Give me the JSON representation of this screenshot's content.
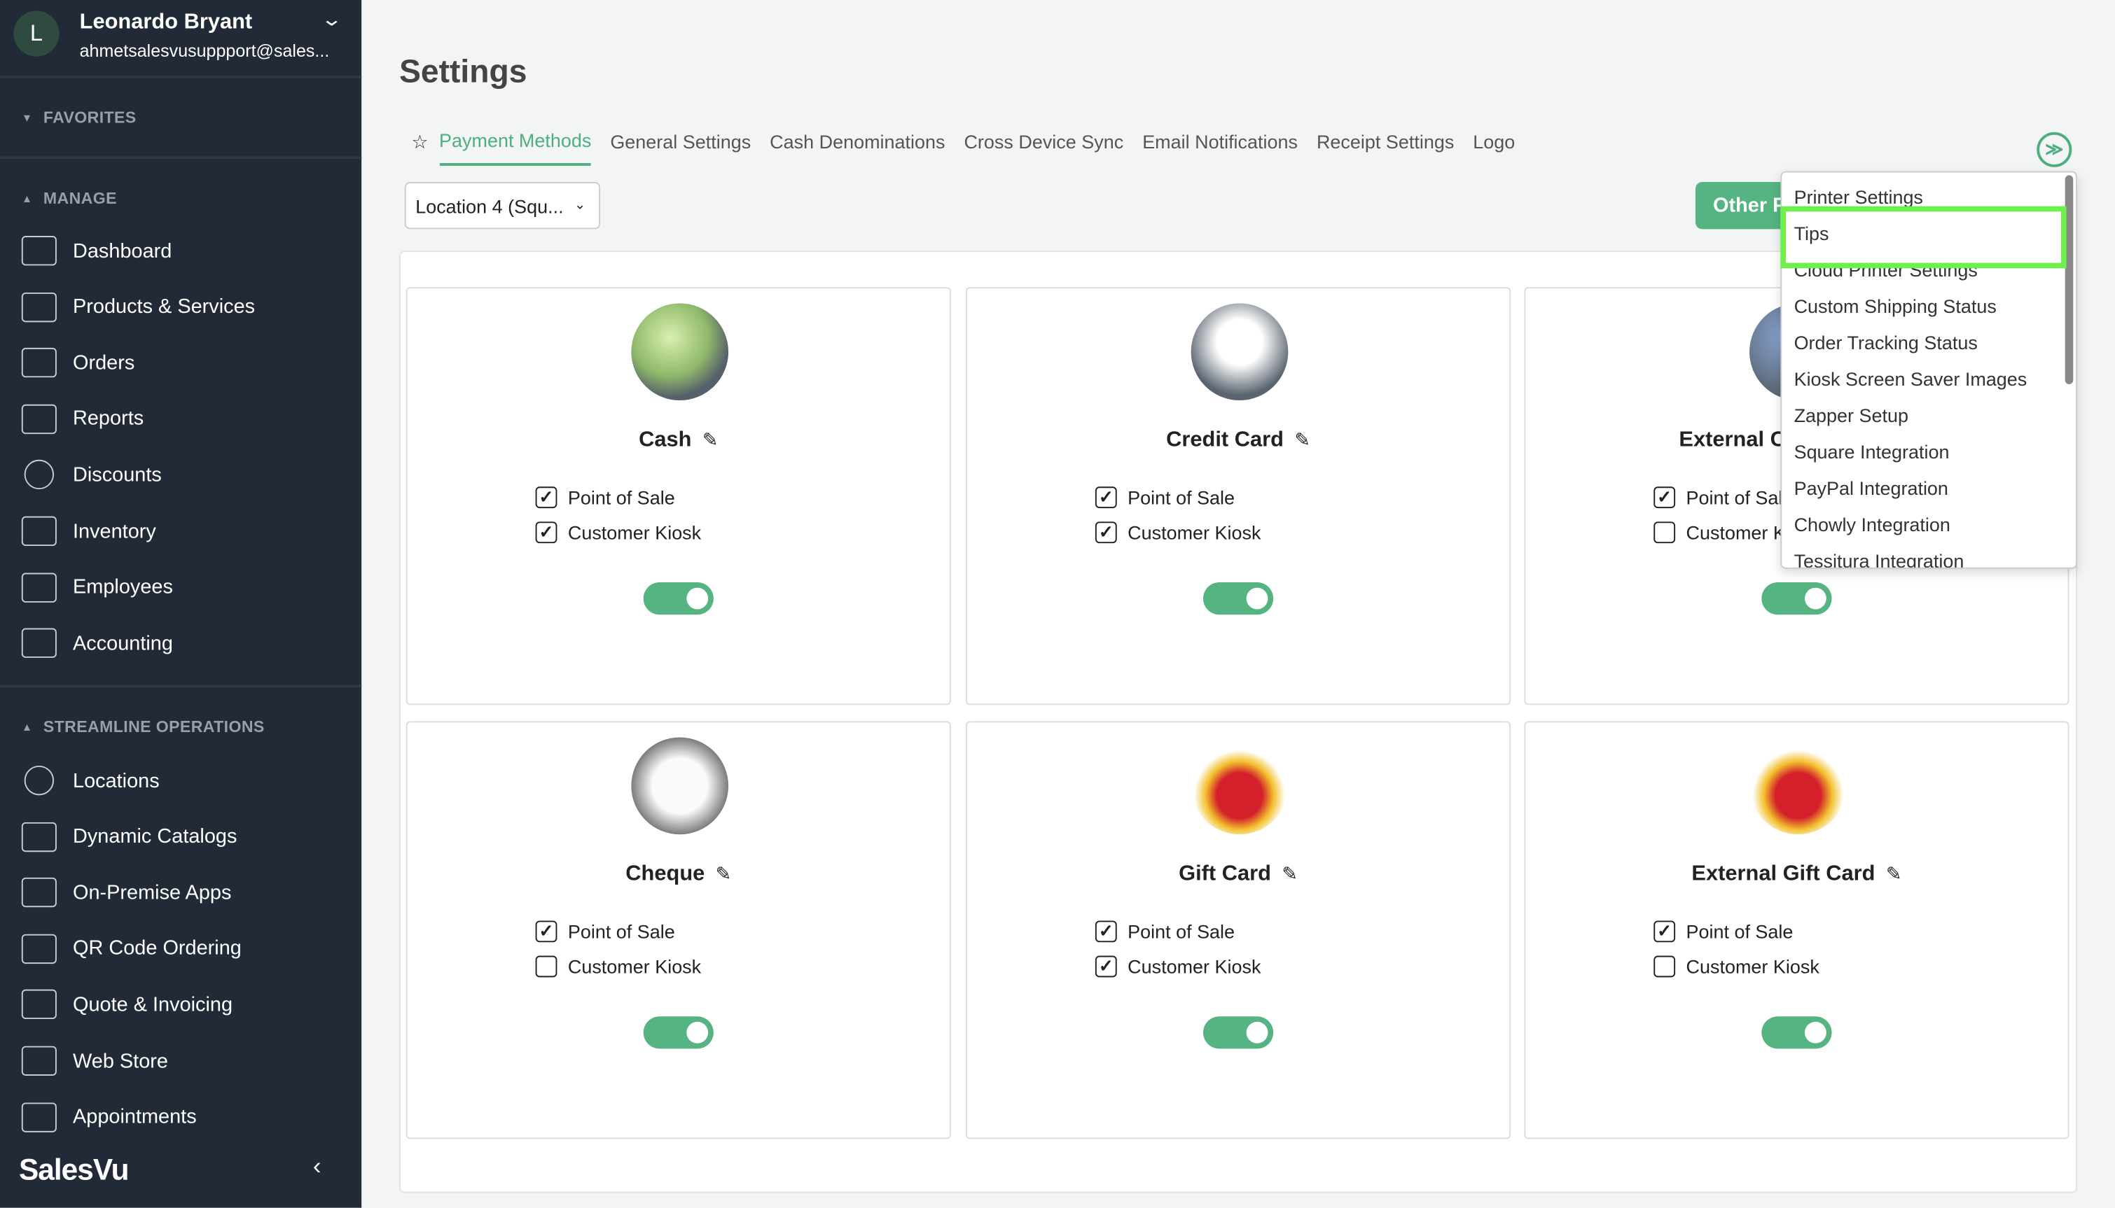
{
  "user": {
    "initial": "L",
    "name": "Leonardo Bryant",
    "email": "ahmetsalesvusuppport@sales..."
  },
  "sidebar": {
    "favorites": "FAVORITES",
    "manage": "MANAGE",
    "streamline": "STREAMLINE OPERATIONS",
    "manage_items": [
      {
        "label": "Dashboard",
        "icon": "monitor-icon"
      },
      {
        "label": "Products & Services",
        "icon": "products-icon"
      },
      {
        "label": "Orders",
        "icon": "orders-icon"
      },
      {
        "label": "Reports",
        "icon": "reports-icon"
      },
      {
        "label": "Discounts",
        "icon": "percent-icon"
      },
      {
        "label": "Inventory",
        "icon": "inventory-icon"
      },
      {
        "label": "Employees",
        "icon": "employees-icon"
      },
      {
        "label": "Accounting",
        "icon": "calculator-icon"
      }
    ],
    "streamline_items": [
      {
        "label": "Locations",
        "icon": "location-pin-icon"
      },
      {
        "label": "Dynamic Catalogs",
        "icon": "catalog-icon"
      },
      {
        "label": "On-Premise Apps",
        "icon": "apps-icon"
      },
      {
        "label": "QR Code Ordering",
        "icon": "qr-code-icon"
      },
      {
        "label": "Quote & Invoicing",
        "icon": "invoice-icon"
      },
      {
        "label": "Web Store",
        "icon": "web-store-icon"
      },
      {
        "label": "Appointments",
        "icon": "calendar-icon"
      }
    ],
    "logo": "SalesVu"
  },
  "page": {
    "title": "Settings"
  },
  "tabs": [
    "Payment Methods",
    "General Settings",
    "Cash Denominations",
    "Cross Device Sync",
    "Email Notifications",
    "Receipt Settings",
    "Logo"
  ],
  "location_select": "Location 4 (Squ...",
  "other_button": "Other Payment Methods",
  "cards": [
    {
      "name": "Cash",
      "pos": true,
      "kiosk": true,
      "enabled": true,
      "icon": "cash-icon"
    },
    {
      "name": "Credit Card",
      "pos": true,
      "kiosk": true,
      "enabled": true,
      "icon": "credit-card-icon"
    },
    {
      "name": "External Credit Card",
      "pos": true,
      "kiosk": false,
      "enabled": true,
      "icon": "card-terminal-icon"
    },
    {
      "name": "Cheque",
      "pos": true,
      "kiosk": false,
      "enabled": true,
      "icon": "cheque-icon"
    },
    {
      "name": "Gift Card",
      "pos": true,
      "kiosk": true,
      "enabled": true,
      "icon": "gift-icon"
    },
    {
      "name": "External Gift Card",
      "pos": true,
      "kiosk": false,
      "enabled": true,
      "icon": "gift-icon"
    }
  ],
  "labels": {
    "pos": "Point of Sale",
    "kiosk": "Customer Kiosk"
  },
  "dropdown": [
    "Printer Settings",
    "Tips",
    "Cloud Printer Settings",
    "Custom Shipping Status",
    "Order Tracking Status",
    "Kiosk Screen Saver Images",
    "Zapper Setup",
    "Square Integration",
    "PayPal Integration",
    "Chowly Integration",
    "Tessitura Integration"
  ],
  "colors": {
    "accent": "#56b482",
    "sidebar": "#222a37",
    "highlight": "#6ef04a"
  }
}
